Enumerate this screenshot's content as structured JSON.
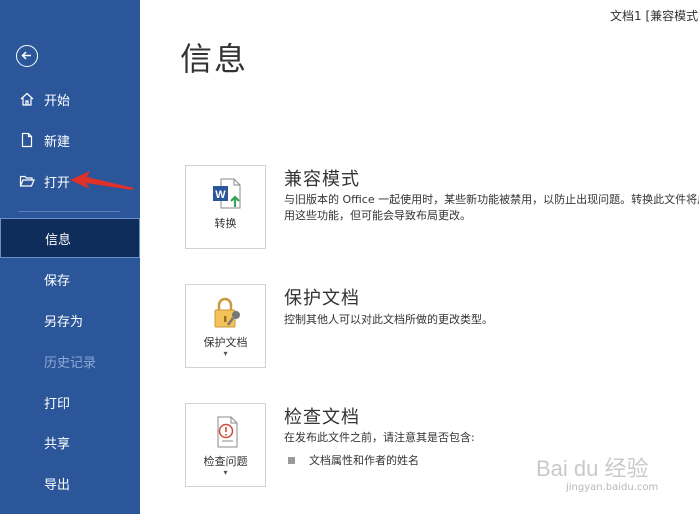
{
  "window": {
    "doc_title": "文档1 [兼容模式]"
  },
  "sidebar": {
    "back_icon": "back-arrow-icon",
    "items": [
      {
        "label": "开始",
        "icon": "home-icon"
      },
      {
        "label": "新建",
        "icon": "new-document-icon"
      },
      {
        "label": "打开",
        "icon": "open-folder-icon"
      },
      {
        "label": "信息",
        "active": true
      },
      {
        "label": "保存"
      },
      {
        "label": "另存为"
      },
      {
        "label": "历史记录",
        "disabled": true
      },
      {
        "label": "打印"
      },
      {
        "label": "共享"
      },
      {
        "label": "导出"
      }
    ]
  },
  "main": {
    "title": "信息",
    "sections": [
      {
        "card_label": "转换",
        "title": "兼容模式",
        "description": "与旧版本的 Office 一起使用时，某些新功能被禁用，以防止出现问题。转换此文件将启用这些功能，但可能会导致布局更改。"
      },
      {
        "card_label": "保护文档",
        "title": "保护文档",
        "description": "控制其他人可以对此文档所做的更改类型。"
      },
      {
        "card_label": "检查问题",
        "title": "检查文档",
        "description": "在发布此文件之前，请注意其是否包含:",
        "bullets": [
          "文档属性和作者的姓名"
        ]
      }
    ]
  },
  "watermark": {
    "text": "Bai du 经验",
    "sub": "jingyan.baidu.com"
  },
  "colors": {
    "sidebar": "#2b579a",
    "active": "#0e2d5a",
    "arrow": "#e0302a"
  }
}
